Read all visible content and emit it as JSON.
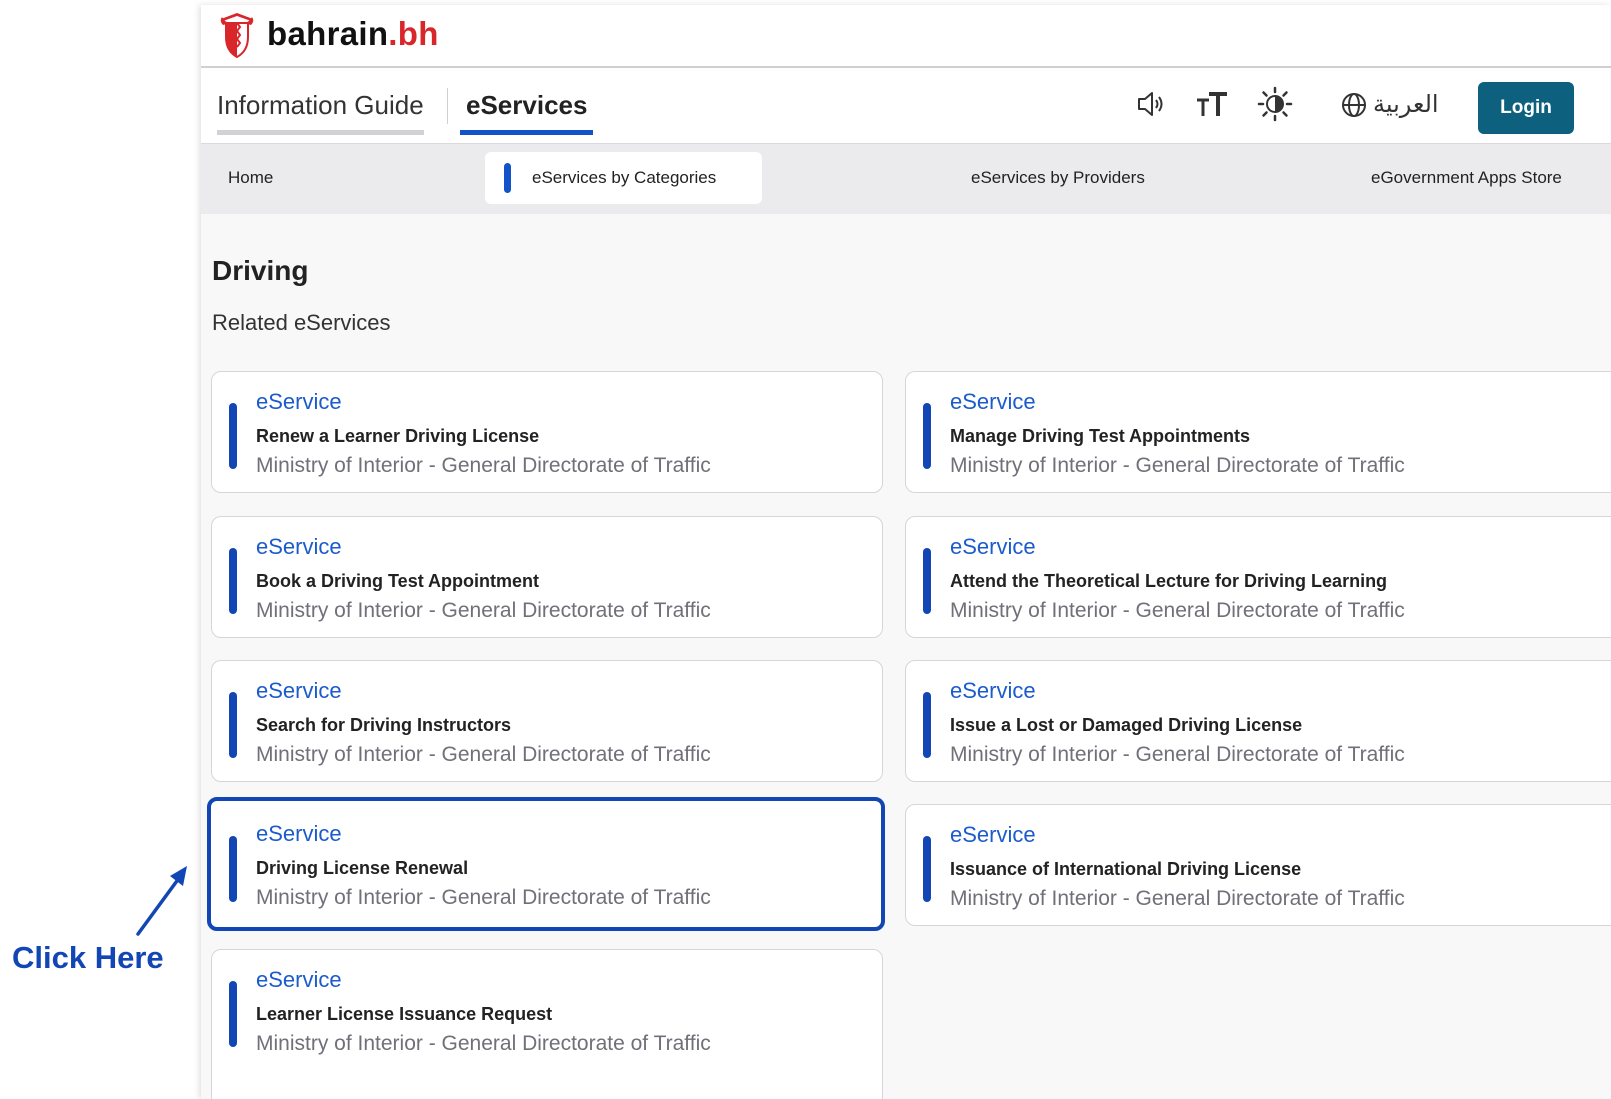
{
  "brand": {
    "name_main": "bahrain",
    "name_suffix": ".bh"
  },
  "nav": {
    "tabs": [
      {
        "label": "Information Guide"
      },
      {
        "label": "eServices"
      }
    ],
    "language_label": "العربية",
    "login_label": "Login"
  },
  "categories": {
    "items": [
      {
        "label": "Home"
      },
      {
        "label": "eServices by Categories"
      },
      {
        "label": "eServices by Providers"
      },
      {
        "label": "eGovernment Apps Store"
      }
    ]
  },
  "section": {
    "title": "Driving",
    "subtitle": "Related eServices"
  },
  "cards": [
    {
      "tag": "eService",
      "name": "Renew a Learner Driving License",
      "provider": "Ministry of Interior - General Directorate of Traffic"
    },
    {
      "tag": "eService",
      "name": "Manage Driving Test Appointments",
      "provider": "Ministry of Interior - General Directorate of Traffic"
    },
    {
      "tag": "eService",
      "name": "Book a Driving Test Appointment",
      "provider": "Ministry of Interior - General Directorate of Traffic"
    },
    {
      "tag": "eService",
      "name": "Attend the Theoretical Lecture for Driving Learning",
      "provider": "Ministry of Interior - General Directorate of Traffic"
    },
    {
      "tag": "eService",
      "name": "Search for Driving Instructors",
      "provider": "Ministry of Interior - General Directorate of Traffic"
    },
    {
      "tag": "eService",
      "name": "Issue a Lost or Damaged Driving License",
      "provider": "Ministry of Interior - General Directorate of Traffic"
    },
    {
      "tag": "eService",
      "name": "Driving License Renewal",
      "provider": "Ministry of Interior - General Directorate of Traffic"
    },
    {
      "tag": "eService",
      "name": "Issuance of International Driving License",
      "provider": "Ministry of Interior - General Directorate of Traffic"
    },
    {
      "tag": "eService",
      "name": "Learner License Issuance Request",
      "provider": "Ministry of Interior - General Directorate of Traffic"
    }
  ],
  "annotation": {
    "label": "Click Here"
  },
  "icons": {
    "emblem": "bahrain-emblem-icon",
    "speaker": "speaker-icon",
    "text_size": "text-size-icon",
    "contrast": "contrast-icon",
    "globe": "globe-icon",
    "arrow": "arrow-icon"
  },
  "colors": {
    "accent": "#1254c7",
    "login": "#0d607e",
    "brand_red": "#d9262a"
  }
}
